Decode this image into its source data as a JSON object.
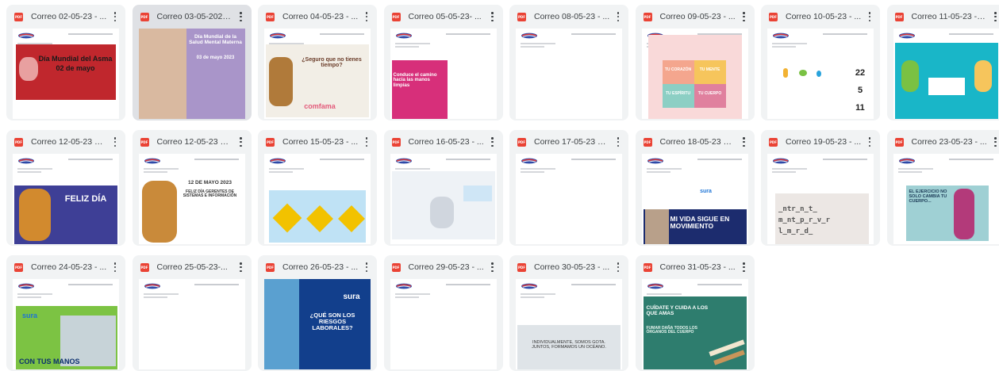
{
  "files": [
    {
      "title": "Correo 02-05-23 - ...",
      "icon": "pdf-icon",
      "thumb_text": [
        "Día Mundial del Asma",
        "02 de mayo"
      ]
    },
    {
      "title": "Correo 03-05-2023...",
      "icon": "pdf-icon",
      "thumb_text": [
        "Día Mundial de la Salud Mental Materna",
        "03 de mayo 2023"
      ]
    },
    {
      "title": "Correo 04-05-23 - ...",
      "icon": "pdf-icon",
      "thumb_text": [
        "¿Seguro que no tienes tiempo?",
        "comfama"
      ]
    },
    {
      "title": "Correo 05-05-23- ...",
      "icon": "pdf-icon",
      "thumb_text": [
        "Conduce el camino hacia las manos limpias"
      ]
    },
    {
      "title": "Correo 08-05-23 - ...",
      "icon": "pdf-icon",
      "thumb_text": []
    },
    {
      "title": "Correo 09-05-23 - ...",
      "icon": "pdf-icon",
      "thumb_text": [
        "TU CORAZÓN",
        "TU MENTE",
        "TU ESPÍRITU",
        "TU CUERPO"
      ]
    },
    {
      "title": "Correo 10-05-23 - ...",
      "icon": "pdf-icon",
      "thumb_text": [
        "22",
        "5",
        "11"
      ]
    },
    {
      "title": "Correo 11-05-23 - P...",
      "icon": "pdf-icon",
      "thumb_text": []
    },
    {
      "title": "Correo 12-05-23 Fe...",
      "icon": "pdf-icon",
      "thumb_text": [
        "FELIZ DÍA"
      ]
    },
    {
      "title": "Correo 12-05-23 Fe...",
      "icon": "pdf-icon",
      "thumb_text": [
        "12 DE MAYO 2023",
        "FELIZ DÍA GERENTES DE SISTEMAS E INFORMACIÓN"
      ]
    },
    {
      "title": "Correo 15-05-23 - ...",
      "icon": "pdf-icon",
      "thumb_text": []
    },
    {
      "title": "Correo 16-05-23 - ...",
      "icon": "pdf-icon",
      "thumb_text": []
    },
    {
      "title": "Correo 17-05-23 Di...",
      "icon": "pdf-icon",
      "thumb_text": []
    },
    {
      "title": "Correo 18-05-23 Us...",
      "icon": "pdf-icon",
      "thumb_text": [
        "sura",
        "MI VIDA SIGUE EN MOVIMIENTO"
      ]
    },
    {
      "title": "Correo 19-05-23 - ...",
      "icon": "pdf-icon",
      "thumb_text": [
        "_ntr_n_t_",
        "m_nt_p_r_v_r",
        "l_m_r_d_"
      ]
    },
    {
      "title": "Correo 23-05-23 - ...",
      "icon": "pdf-icon",
      "thumb_text": [
        "EL EJERCICIO NO SOLO CAMBIA TU CUERPO..."
      ]
    },
    {
      "title": "Correo 24-05-23 - ...",
      "icon": "pdf-icon",
      "thumb_text": [
        "sura",
        "CON TUS MANOS"
      ]
    },
    {
      "title": "Correo 25-05-23-...",
      "icon": "pdf-icon",
      "thumb_text": []
    },
    {
      "title": "Correo 26-05-23 - ...",
      "icon": "pdf-icon",
      "thumb_text": [
        "sura",
        "¿QUÉ SON LOS RIESGOS LABORALES?"
      ]
    },
    {
      "title": "Correo 29-05-23 - ...",
      "icon": "pdf-icon",
      "thumb_text": []
    },
    {
      "title": "Correo 30-05-23 - ...",
      "icon": "pdf-icon",
      "thumb_text": [
        "INDIVIDUALMENTE, SOMOS GOTA. JUNTOS, FORMAMOS UN OCÉANO."
      ]
    },
    {
      "title": "Correo 31-05-23 - ...",
      "icon": "pdf-icon",
      "thumb_text": [
        "CUÍDATE Y CUIDA A LOS QUE AMAS",
        "FUMAR DAÑA TODOS LOS ÓRGANOS DEL CUERPO"
      ]
    }
  ],
  "selected_index": 1,
  "colors": {
    "card_bg": "#f1f3f4",
    "card_selected_bg": "#dfe1e5",
    "pdf_red": "#ea4335",
    "title_text": "#3c4043"
  }
}
